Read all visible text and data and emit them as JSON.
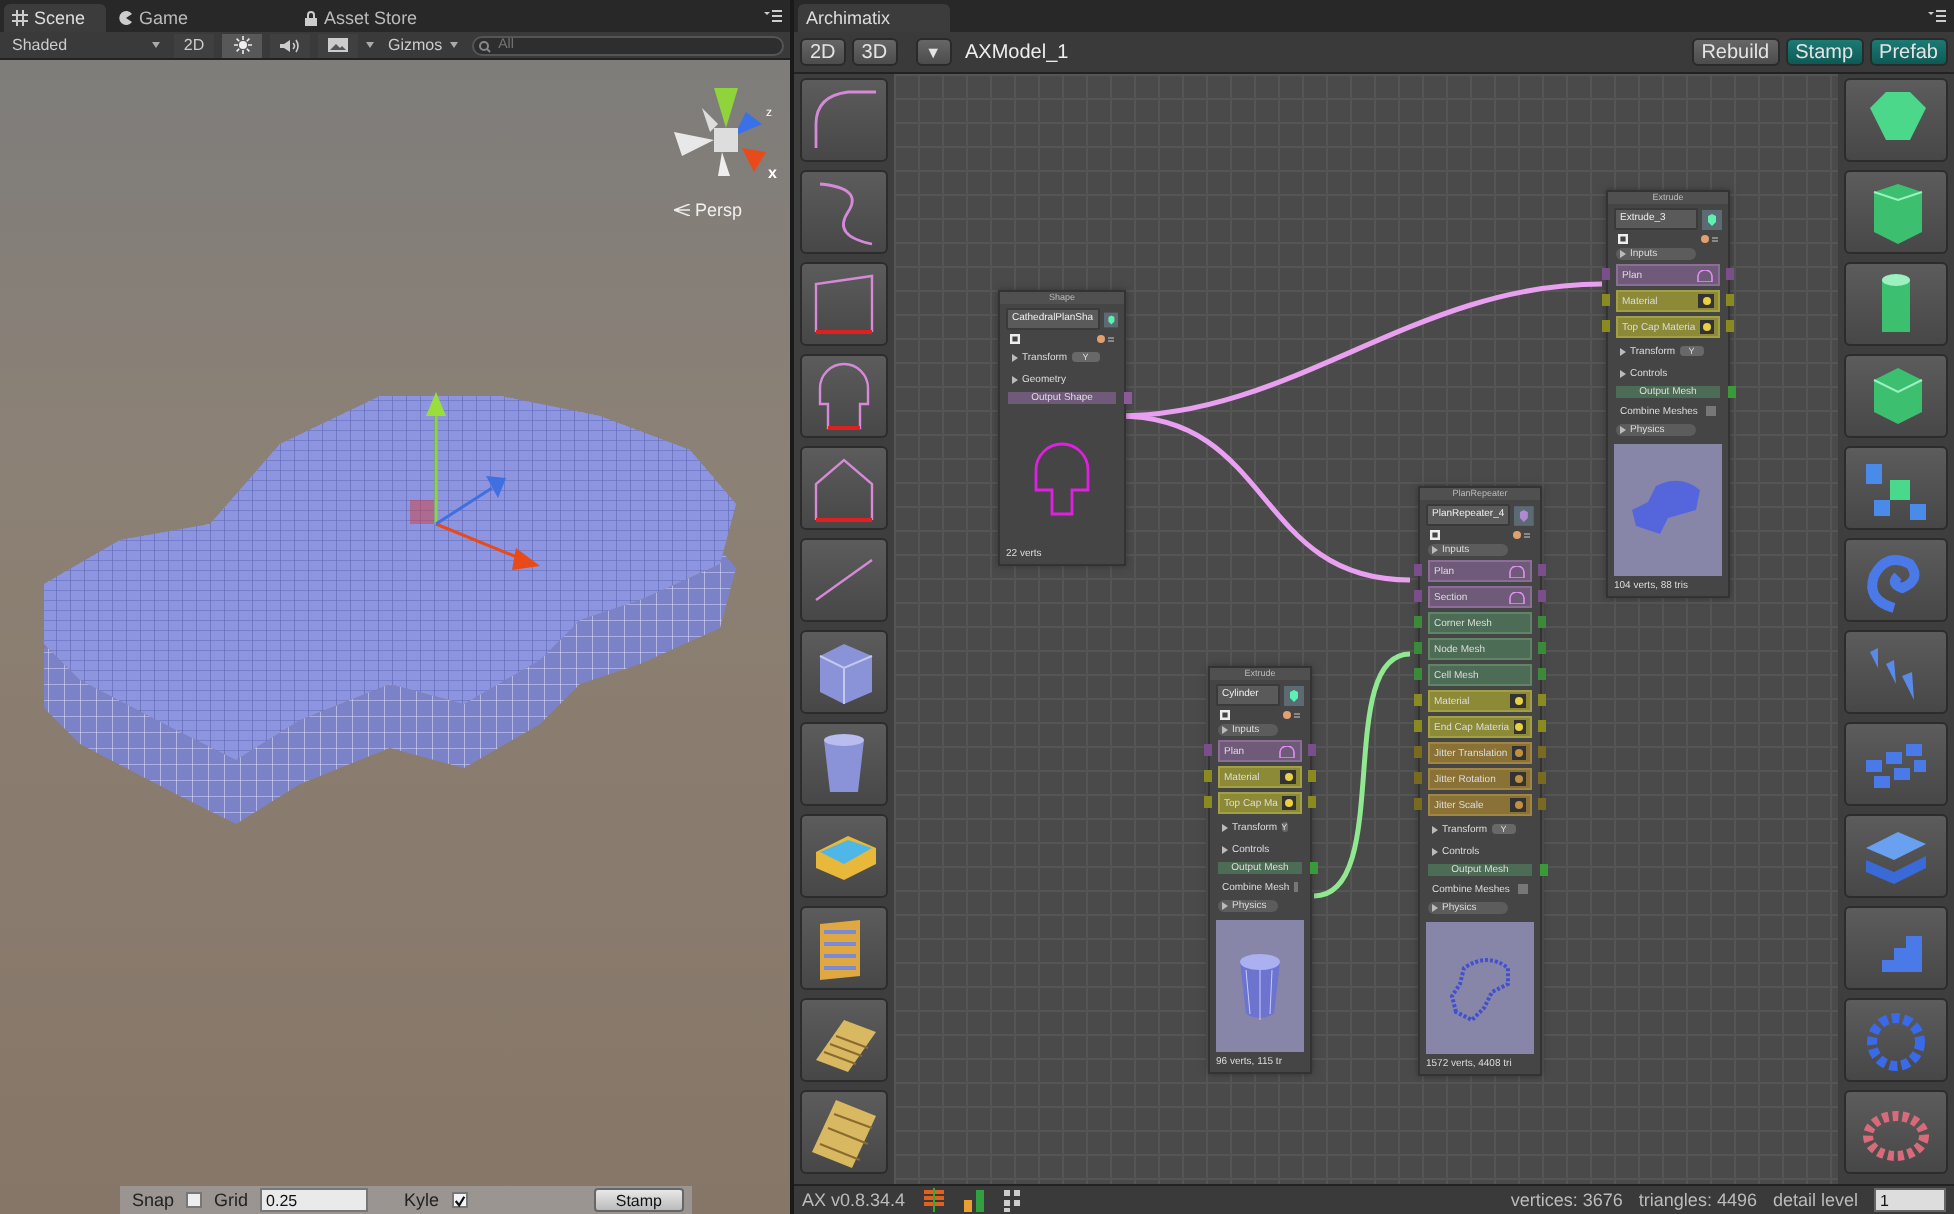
{
  "scene_window": {
    "tabs": [
      {
        "label": "Scene",
        "selected": true
      },
      {
        "label": "Game",
        "selected": false
      },
      {
        "label": "Asset Store",
        "selected": false
      }
    ],
    "toolbar": {
      "shading": "Shaded",
      "toggles": [
        {
          "kind": "text",
          "label": "2D",
          "selected": false
        },
        {
          "kind": "light",
          "selected": true
        },
        {
          "kind": "audio",
          "selected": false
        },
        {
          "kind": "image",
          "selected": false
        }
      ],
      "gizmos": "Gizmos",
      "search_placeholder": "All"
    },
    "axis_labels": [
      "z",
      "x"
    ],
    "view_label": "Persp",
    "bottom_bar": {
      "snap_label": "Snap",
      "snap_checked": false,
      "grid_label": "Grid",
      "grid_value": "0.25",
      "kyle_label": "Kyle",
      "kyle_checked": true,
      "stamp_button": "Stamp"
    }
  },
  "archimatix": {
    "tab": "Archimatix",
    "toolbar": {
      "view_buttons": [
        "2D",
        "3D"
      ],
      "menu_glyph": "▼",
      "model_name": "AXModel_1",
      "actions": [
        {
          "label": "Rebuild",
          "kind": "plain"
        },
        {
          "label": "Stamp",
          "kind": "accent"
        },
        {
          "label": "Prefab",
          "kind": "accent"
        }
      ]
    },
    "nodes": [
      {
        "category": "Shape",
        "name": "CathedralPlanSha",
        "preview": {
          "kind": "outline"
        },
        "enabled": true,
        "footer": "22 verts",
        "rows": [
          {
            "kind": "foldout",
            "label": "Transform",
            "value": "Y"
          },
          {
            "kind": "foldout",
            "label": "Geometry"
          },
          {
            "kind": "output_shape",
            "label": "Output Shape"
          }
        ]
      },
      {
        "category": "Extrude",
        "name": "Cylinder",
        "preview": {
          "kind": "cylinder"
        },
        "enabled": true,
        "footer": "96 verts, 115 tr",
        "rows": [
          {
            "kind": "header",
            "label": "Inputs"
          },
          {
            "kind": "shape_port",
            "label": "Plan"
          },
          {
            "kind": "material",
            "label": "Material"
          },
          {
            "kind": "material",
            "label": "Top Cap Ma"
          },
          {
            "kind": "foldout",
            "label": "Transform",
            "value": "Y"
          },
          {
            "kind": "foldout",
            "label": "Controls"
          },
          {
            "kind": "output_mesh",
            "label": "Output Mesh"
          },
          {
            "kind": "toggle",
            "label": "Combine Mesh",
            "checked": false
          },
          {
            "kind": "header",
            "label": "Physics"
          }
        ]
      },
      {
        "category": "PlanRepeater",
        "name": "PlanRepeater_4",
        "preview": {
          "kind": "ring"
        },
        "enabled": true,
        "footer": "1572 verts, 4408 tri",
        "rows": [
          {
            "kind": "header",
            "label": "Inputs"
          },
          {
            "kind": "shape_port",
            "label": "Plan"
          },
          {
            "kind": "shape_port",
            "label": "Section"
          },
          {
            "kind": "mesh_port",
            "label": "Corner Mesh"
          },
          {
            "kind": "mesh_port",
            "label": "Node Mesh"
          },
          {
            "kind": "mesh_port",
            "label": "Cell Mesh"
          },
          {
            "kind": "material",
            "label": "Material"
          },
          {
            "kind": "material",
            "label": "End Cap Materia"
          },
          {
            "kind": "jitter",
            "label": "Jitter Translation"
          },
          {
            "kind": "jitter",
            "label": "Jitter Rotation"
          },
          {
            "kind": "jitter",
            "label": "Jitter Scale"
          },
          {
            "kind": "foldout",
            "label": "Transform",
            "value": "Y"
          },
          {
            "kind": "foldout",
            "label": "Controls"
          },
          {
            "kind": "output_mesh",
            "label": "Output Mesh"
          },
          {
            "kind": "toggle",
            "label": "Combine Meshes",
            "checked": false
          },
          {
            "kind": "header",
            "label": "Physics"
          }
        ]
      },
      {
        "category": "Extrude",
        "name": "Extrude_3",
        "preview": {
          "kind": "arch"
        },
        "enabled": true,
        "footer": "104 verts, 88 tris",
        "rows": [
          {
            "kind": "header",
            "label": "Inputs"
          },
          {
            "kind": "shape_port",
            "label": "Plan"
          },
          {
            "kind": "material",
            "label": "Material"
          },
          {
            "kind": "material",
            "label": "Top Cap Materia"
          },
          {
            "kind": "foldout",
            "label": "Transform",
            "value": "Y"
          },
          {
            "kind": "foldout",
            "label": "Controls"
          },
          {
            "kind": "output_mesh",
            "label": "Output Mesh"
          },
          {
            "kind": "toggle",
            "label": "Combine Meshes",
            "checked": false
          },
          {
            "kind": "header",
            "label": "Physics"
          }
        ]
      }
    ],
    "status_bar": {
      "version": "AX v0.8.34.4",
      "vertices": "vertices: 3676",
      "triangles": "triangles: 4496",
      "detail_label": "detail level",
      "detail_value": "1"
    }
  }
}
